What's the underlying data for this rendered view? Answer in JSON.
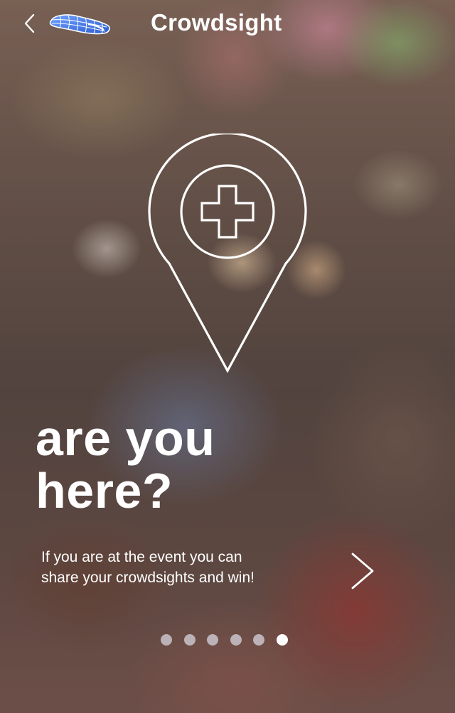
{
  "header": {
    "title": "Crowdsight",
    "back_icon": "chevron-left-icon",
    "logo_icon": "crowdsight-logo-icon"
  },
  "hero": {
    "icon": "map-pin-plus-icon",
    "headline_line1": "are you",
    "headline_line2": "here?",
    "description_line1": "If you are at the event you can",
    "description_line2": "share your crowdsights and win!"
  },
  "navigation": {
    "next_icon": "chevron-right-icon"
  },
  "pagination": {
    "total_pages": 6,
    "current_page": 6
  },
  "colors": {
    "text": "#ffffff",
    "logo_blue": "#3a6fd8",
    "dot_inactive": "#d7d4de",
    "dot_active": "#ffffff"
  }
}
